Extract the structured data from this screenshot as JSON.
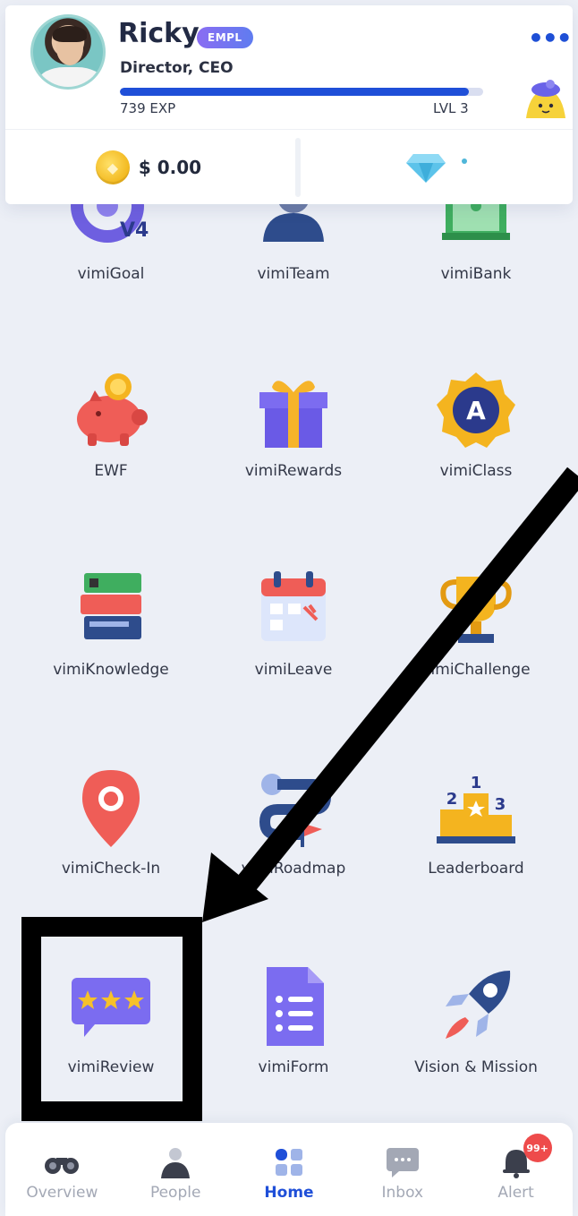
{
  "profile": {
    "name": "Ricky",
    "role_badge": "EMPL",
    "title": "Director, CEO",
    "exp": "739 EXP",
    "level": "LVL 3",
    "exp_progress": 0.96
  },
  "wallet": {
    "balance": "$ 0.00"
  },
  "apps": [
    {
      "label": "vimiGoal",
      "icon": "goal-icon"
    },
    {
      "label": "vimiTeam",
      "icon": "team-icon"
    },
    {
      "label": "vimiBank",
      "icon": "bank-icon"
    },
    {
      "label": "EWF",
      "icon": "piggy-bank-icon"
    },
    {
      "label": "vimiRewards",
      "icon": "gift-icon"
    },
    {
      "label": "vimiClass",
      "icon": "class-badge-icon"
    },
    {
      "label": "vimiKnowledge",
      "icon": "books-icon"
    },
    {
      "label": "vimiLeave",
      "icon": "calendar-icon"
    },
    {
      "label": "vimiChallenge",
      "icon": "trophy-icon"
    },
    {
      "label": "vimiCheck-In",
      "icon": "location-pin-icon"
    },
    {
      "label": "vimiRoadmap",
      "icon": "roadmap-icon"
    },
    {
      "label": "Leaderboard",
      "icon": "podium-icon"
    },
    {
      "label": "vimiReview",
      "icon": "review-stars-icon"
    },
    {
      "label": "vimiForm",
      "icon": "form-icon"
    },
    {
      "label": "Vision & Mission",
      "icon": "rocket-icon"
    }
  ],
  "goal_icon_text": "V4",
  "class_icon_text": "A",
  "podium_labels": [
    "2",
    "1",
    "3"
  ],
  "bottom_nav": [
    {
      "label": "Overview",
      "icon": "binoculars-icon"
    },
    {
      "label": "People",
      "icon": "person-icon"
    },
    {
      "label": "Home",
      "icon": "grid-icon",
      "active": true
    },
    {
      "label": "Inbox",
      "icon": "chat-icon"
    },
    {
      "label": "Alert",
      "icon": "bell-icon",
      "badge": "99+"
    }
  ],
  "colors": {
    "accent": "#1f4fd8",
    "background": "#eceff6",
    "alert": "#ee4b4b"
  }
}
